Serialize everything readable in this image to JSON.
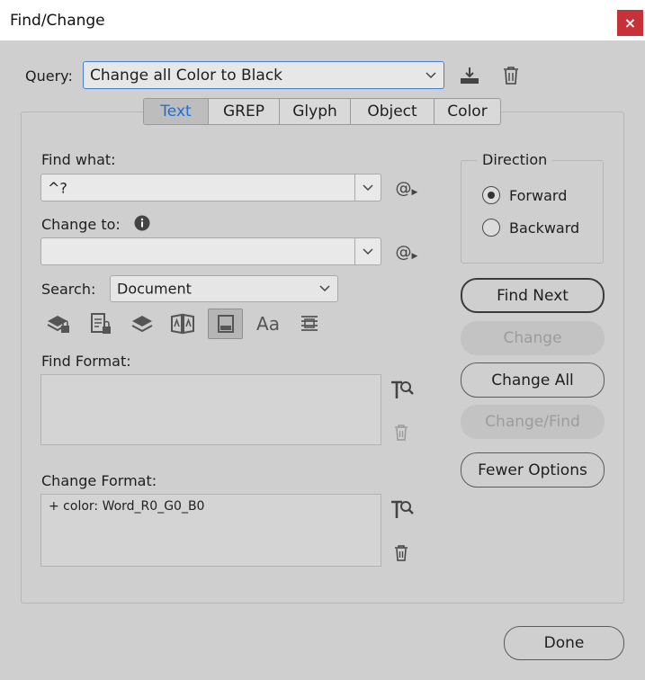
{
  "window": {
    "title": "Find/Change",
    "close_label": "×"
  },
  "query": {
    "label": "Query:",
    "value": "Change all Color to Black"
  },
  "tabs": [
    {
      "label": "Text",
      "active": true
    },
    {
      "label": "GREP"
    },
    {
      "label": "Glyph"
    },
    {
      "label": "Object"
    },
    {
      "label": "Color"
    }
  ],
  "find_what": {
    "label": "Find what:",
    "value": "^?"
  },
  "change_to": {
    "label": "Change to:",
    "value": ""
  },
  "special_char_label": "@",
  "search": {
    "label": "Search:",
    "value": "Document"
  },
  "find_format": {
    "label": "Find Format:",
    "value": ""
  },
  "change_format": {
    "label": "Change Format:",
    "value": "+ color: Word_R0_G0_B0"
  },
  "direction": {
    "label": "Direction",
    "options": [
      {
        "label": "Forward",
        "selected": true
      },
      {
        "label": "Backward",
        "selected": false
      }
    ]
  },
  "buttons": {
    "find_next": "Find Next",
    "change": "Change",
    "change_all": "Change All",
    "change_find": "Change/Find",
    "fewer_options": "Fewer Options",
    "done": "Done"
  },
  "colors": {
    "accent": "#1f6fd2",
    "close": "#c8313a",
    "background": "#cfcfcf"
  }
}
